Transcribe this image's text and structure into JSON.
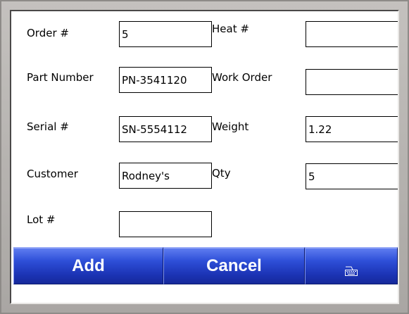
{
  "form": {
    "labels": {
      "order": "Order #",
      "part_number": "Part Number",
      "serial": "Serial #",
      "customer": "Customer",
      "lot": "Lot #",
      "heat": "Heat #",
      "work_order": "Work Order",
      "weight": "Weight",
      "qty": "Qty"
    },
    "values": {
      "order": "5",
      "part_number": "PN-3541120",
      "serial": "SN-5554112",
      "customer": "Rodney's",
      "lot": "",
      "heat": "",
      "work_order": "",
      "weight": "1.22",
      "qty": "5"
    }
  },
  "buttons": {
    "add_label": "Add",
    "cancel_label": "Cancel",
    "keyboard_icon": "keyboard-icon"
  },
  "colors": {
    "button_blue": "#2e4fd8",
    "frame_gray": "#b9b6b3"
  }
}
